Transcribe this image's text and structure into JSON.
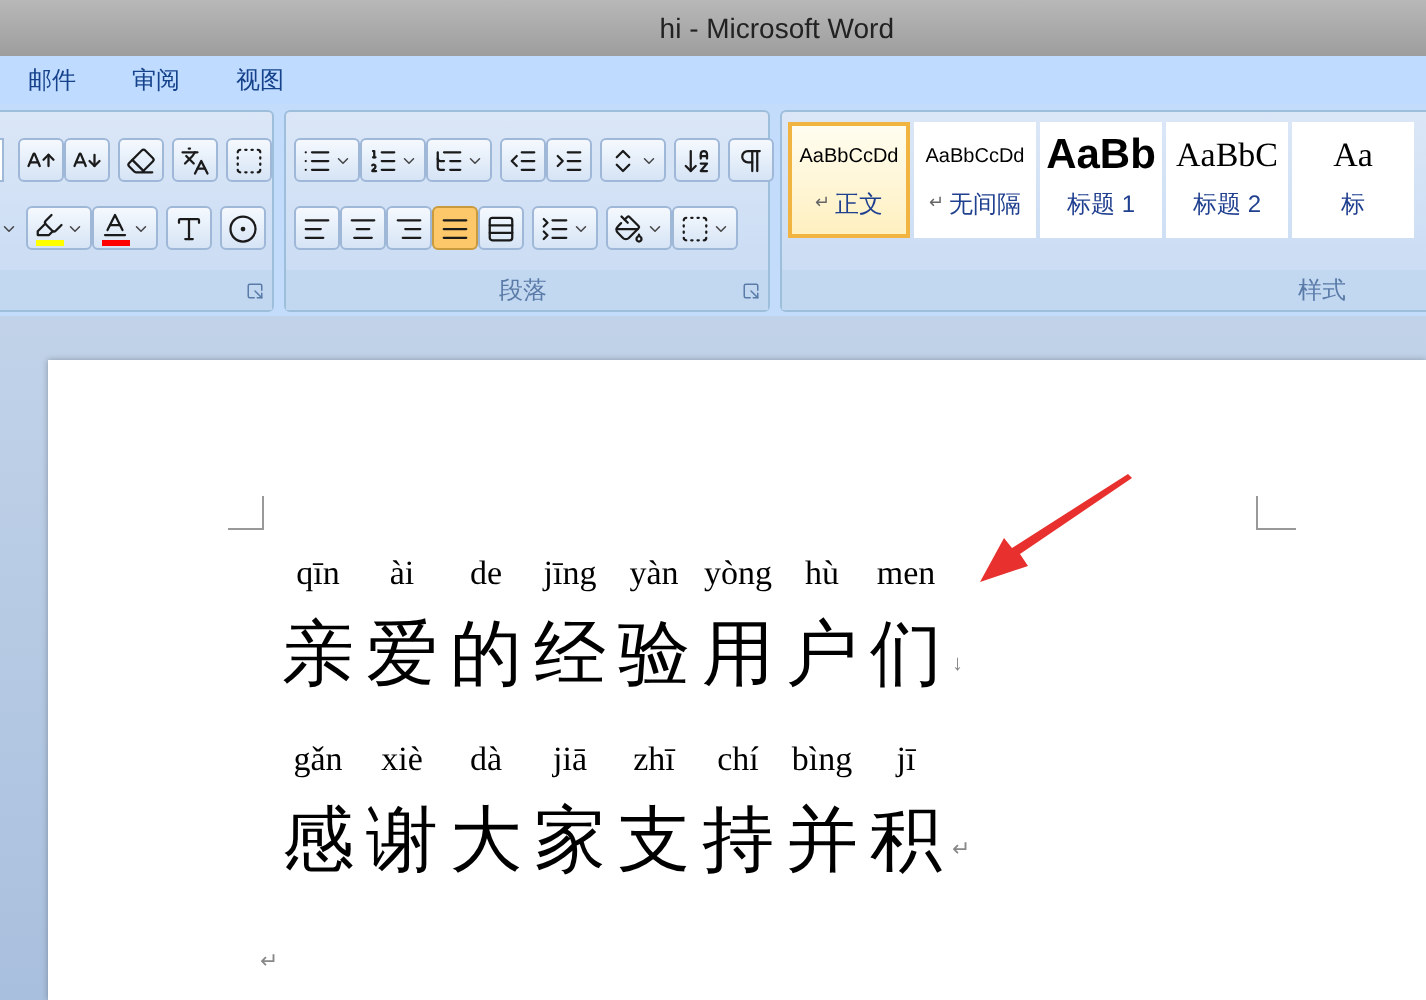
{
  "window": {
    "title": "hi - Microsoft Word"
  },
  "tabs": [
    {
      "label": "邮件",
      "selected": false
    },
    {
      "label": "审阅",
      "selected": false
    },
    {
      "label": "视图",
      "selected": false
    }
  ],
  "ribbon": {
    "paragraph": {
      "label": "段落",
      "alignment": [
        {
          "selected": false
        },
        {
          "selected": false
        },
        {
          "selected": false
        },
        {
          "selected": true
        },
        {
          "selected": false
        }
      ]
    },
    "styles": {
      "label": "样式",
      "items": [
        {
          "kind": "normal",
          "preview": "AaBbCcDd",
          "mark": "↵",
          "name": "正文",
          "selected": true
        },
        {
          "kind": "normal",
          "preview": "AaBbCcDd",
          "mark": "↵",
          "name": "无间隔",
          "selected": false
        },
        {
          "kind": "heading1",
          "preview": "AaBb",
          "name": "标题 1",
          "selected": false
        },
        {
          "kind": "heading2",
          "preview": "AaBbC",
          "name": "标题 2",
          "selected": false
        },
        {
          "kind": "heading2",
          "preview": "Aa",
          "name": "标",
          "selected": false
        }
      ]
    }
  },
  "document": {
    "lines": [
      {
        "chars": [
          {
            "pinyin": "qīn",
            "hanzi": "亲"
          },
          {
            "pinyin": "ài",
            "hanzi": "爱"
          },
          {
            "pinyin": "de",
            "hanzi": "的"
          },
          {
            "pinyin": "jīng",
            "hanzi": "经"
          },
          {
            "pinyin": "yàn",
            "hanzi": "验"
          },
          {
            "pinyin": "yòng",
            "hanzi": "用"
          },
          {
            "pinyin": "hù",
            "hanzi": "户"
          },
          {
            "pinyin": "men",
            "hanzi": "们"
          }
        ],
        "end_mark": "↓"
      },
      {
        "chars": [
          {
            "pinyin": "gǎn",
            "hanzi": "感"
          },
          {
            "pinyin": "xiè",
            "hanzi": "谢"
          },
          {
            "pinyin": "dà",
            "hanzi": "大"
          },
          {
            "pinyin": "jiā",
            "hanzi": "家"
          },
          {
            "pinyin": "zhī",
            "hanzi": "支"
          },
          {
            "pinyin": "chí",
            "hanzi": "持"
          },
          {
            "pinyin": "bìng",
            "hanzi": "并"
          },
          {
            "pinyin": "jī",
            "hanzi": "积"
          }
        ],
        "end_mark": "↵"
      }
    ],
    "final_mark": "↵"
  }
}
